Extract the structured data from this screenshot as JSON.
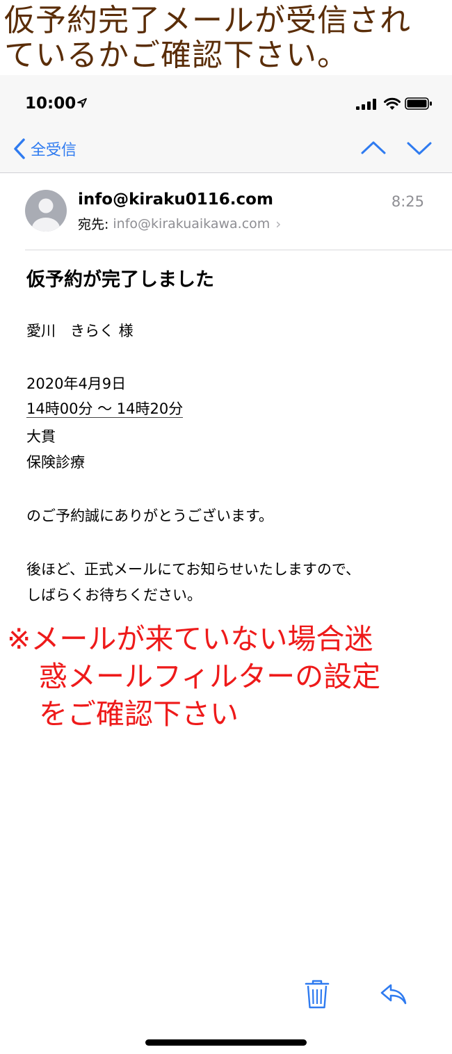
{
  "banner": {
    "line1": "仮予約完了メールが受信され",
    "line2": "ているかご確認下さい。"
  },
  "status_bar": {
    "time": "10:00",
    "icons": [
      "location-arrow-icon",
      "signal-icon",
      "wifi-icon",
      "battery-icon"
    ]
  },
  "nav": {
    "back_label": "全受信",
    "icons": [
      "chevron-left-icon",
      "chevron-up-icon",
      "chevron-down-icon"
    ],
    "accent_color": "#2f7bf0"
  },
  "email": {
    "sender": "info@kiraku0116.com",
    "time": "8:25",
    "to_label": "宛先:",
    "to_address": "info@kirakuaikawa.com",
    "subject": "仮予約が完了しました",
    "body": {
      "greeting": "愛川　きらく 様",
      "date": "2020年4月9日",
      "time_range": "14時00分 〜 14時20分",
      "doctor": "大貫",
      "treatment": "保険診療",
      "thanks": "のご予約誠にありがとうございます。",
      "followup_line1": "後ほど、正式メールにてお知らせいたしますので、",
      "followup_line2": "しばらくお待ちください。"
    }
  },
  "notice": {
    "line1": "※メールが来ていない場合迷",
    "line2": "惑メールフィルターの設定",
    "line3": "をご確認下さい",
    "color": "#ee1a1a"
  },
  "toolbar": {
    "icons": [
      "trash-icon",
      "reply-icon"
    ]
  }
}
